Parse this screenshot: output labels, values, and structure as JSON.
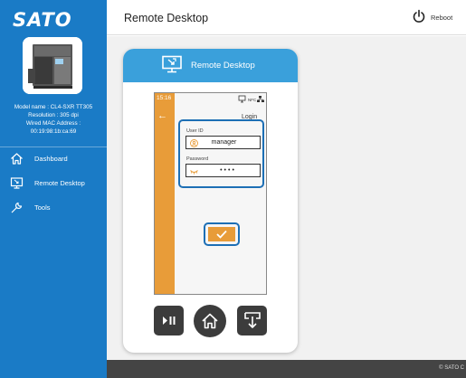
{
  "brand": {
    "logo_text": "SATO"
  },
  "device": {
    "model": "Model name : CL4-SXR TT305",
    "resolution": "Resolution : 305 dpi",
    "mac_label": "Wired MAC Address :",
    "mac_value": "00:19:98:1b:ca:69"
  },
  "sidebar": {
    "items": [
      {
        "label": "Dashboard",
        "icon": "home-icon"
      },
      {
        "label": "Remote Desktop",
        "icon": "monitor-icon"
      },
      {
        "label": "Tools",
        "icon": "wrench-icon"
      }
    ]
  },
  "header": {
    "title": "Remote Desktop",
    "reboot_label": "Reboot",
    "reboot_icon": "power-icon"
  },
  "remote_card": {
    "title": "Remote Desktop",
    "icon": "remote-monitor-icon"
  },
  "printer_screen": {
    "time": "15:16",
    "heading": "Login",
    "user_id_label": "User ID",
    "user_id_value": "manager",
    "password_label": "Password",
    "password_value": "••••",
    "accent_color": "#e89c39",
    "highlight_color": "#1d6fb5"
  },
  "controls": [
    {
      "name": "play-pause",
      "icon": "play-pause-icon"
    },
    {
      "name": "home",
      "icon": "home-icon"
    },
    {
      "name": "feed",
      "icon": "feed-icon"
    }
  ],
  "footer": {
    "text": "© SATO C"
  },
  "colors": {
    "sidebar": "#1a7bc6",
    "card_header": "#3aa0db",
    "footer": "#444444"
  }
}
